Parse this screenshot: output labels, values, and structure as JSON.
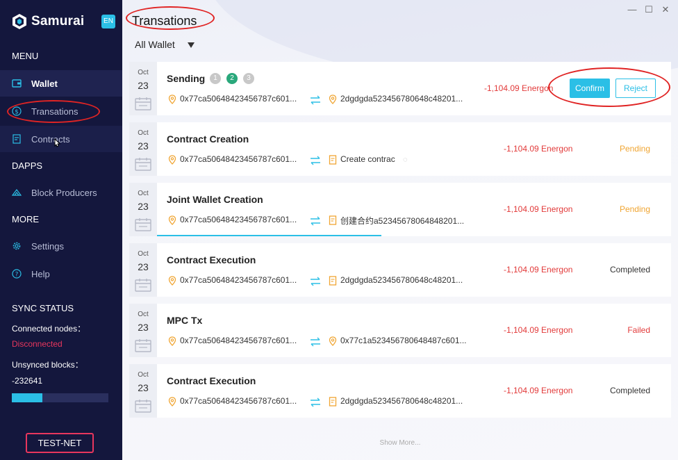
{
  "app": {
    "name": "Samurai",
    "lang": "EN"
  },
  "sidebar": {
    "menu_label": "MENU",
    "items": [
      {
        "label": "Wallet",
        "icon": "wallet-icon"
      },
      {
        "label": "Transations",
        "icon": "dollar-circle-icon"
      },
      {
        "label": "Contracts",
        "icon": "contract-icon"
      }
    ],
    "dapps_label": "DAPPS",
    "dapps_items": [
      {
        "label": "Block Producers",
        "icon": "block-producers-icon"
      }
    ],
    "more_label": "MORE",
    "more_items": [
      {
        "label": "Settings",
        "icon": "gear-icon"
      },
      {
        "label": "Help",
        "icon": "help-icon"
      }
    ],
    "sync": {
      "title": "SYNC STATUS",
      "connected_label": "Connected nodes：",
      "connected_value": "Disconnected",
      "unsynced_label": "Unsynced blocks：",
      "unsynced_value": "-232641",
      "progress": 0.32
    },
    "network_button": "TEST-NET"
  },
  "main": {
    "title": "Transations",
    "filter": "All Wallet",
    "window_controls": {
      "minimize": "—",
      "maximize": "☐",
      "close": "✕"
    },
    "transactions": [
      {
        "month": "Oct",
        "day": "23",
        "title": "Sending",
        "steps": [
          "1",
          "2",
          "3"
        ],
        "from": "0x77ca50648423456787c601...",
        "to": "2dgdgda523456780648c48201...",
        "to_icon": "location-pin-icon",
        "amount": "-1,104.09 Energon",
        "confirm_label": "Confirm",
        "reject_label": "Reject"
      },
      {
        "month": "Oct",
        "day": "23",
        "title": "Contract Creation",
        "from": "0x77ca50648423456787c601...",
        "to": "Create contrac",
        "to_icon": "document-icon",
        "amount": "-1,104.09 Energon",
        "status": "Pending",
        "status_color": "#f0a532"
      },
      {
        "month": "Oct",
        "day": "23",
        "title": "Joint Wallet Creation",
        "from": "0x77ca50648423456787c601...",
        "to": "创建合约a52345678064848201...",
        "to_icon": "document-icon",
        "amount": "-1,104.09 Energon",
        "status": "Pending",
        "status_color": "#f0a532",
        "progress": 0.4
      },
      {
        "month": "Oct",
        "day": "23",
        "title": "Contract Execution",
        "from": "0x77ca50648423456787c601...",
        "to": "2dgdgda523456780648c48201...",
        "to_icon": "document-icon",
        "amount": "-1,104.09 Energon",
        "status": "Completed",
        "status_color": "#333333"
      },
      {
        "month": "Oct",
        "day": "23",
        "title": "MPC Tx",
        "from": "0x77ca50648423456787c601...",
        "to": "0x77c1a523456780648487c601...",
        "to_icon": "location-pin-icon",
        "amount": "-1,104.09 Energon",
        "status": "Failed",
        "status_color": "#e23a3a"
      },
      {
        "month": "Oct",
        "day": "23",
        "title": "Contract Execution",
        "from": "0x77ca50648423456787c601...",
        "to": "2dgdgda523456780648c48201...",
        "to_icon": "document-icon",
        "amount": "-1,104.09 Energon",
        "status": "Completed",
        "status_color": "#333333"
      }
    ],
    "show_more": "Show More..."
  }
}
